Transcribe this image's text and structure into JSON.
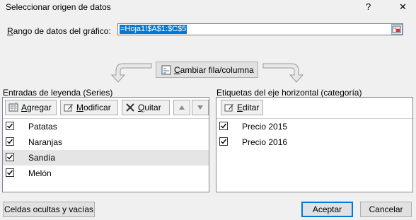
{
  "dialog": {
    "title": "Seleccionar origen de datos",
    "help": "?",
    "close": "✕"
  },
  "range": {
    "label_pre": "",
    "label_ul": "R",
    "label_post": "ango de datos del gráfico:",
    "value": "=Hoja1!$A$1:$C$5"
  },
  "switch_button": {
    "label_ul": "C",
    "label_post": "ambiar fila/columna"
  },
  "legend": {
    "title": "Entradas de leyenda (Series)",
    "add": {
      "pre": "",
      "ul": "A",
      "post": "gregar"
    },
    "edit": {
      "pre": "",
      "ul": "M",
      "post": "odificar"
    },
    "remove": {
      "pre": "",
      "ul": "Q",
      "post": "uitar"
    },
    "items": [
      {
        "label": "Patatas",
        "checked": true
      },
      {
        "label": "Naranjas",
        "checked": true
      },
      {
        "label": "Sandía",
        "checked": true,
        "selected": true
      },
      {
        "label": "Melón",
        "checked": true
      }
    ]
  },
  "axis": {
    "title": "Etiquetas del eje horizontal (categoría)",
    "edit": {
      "pre": "",
      "ul": "E",
      "post": "ditar"
    },
    "items": [
      {
        "label": "Precio 2015",
        "checked": true
      },
      {
        "label": "Precio 2016",
        "checked": true
      }
    ]
  },
  "footer": {
    "hidden_cells": "Celdas ocultas y vacías",
    "accept": "Aceptar",
    "cancel": "Cancelar"
  }
}
